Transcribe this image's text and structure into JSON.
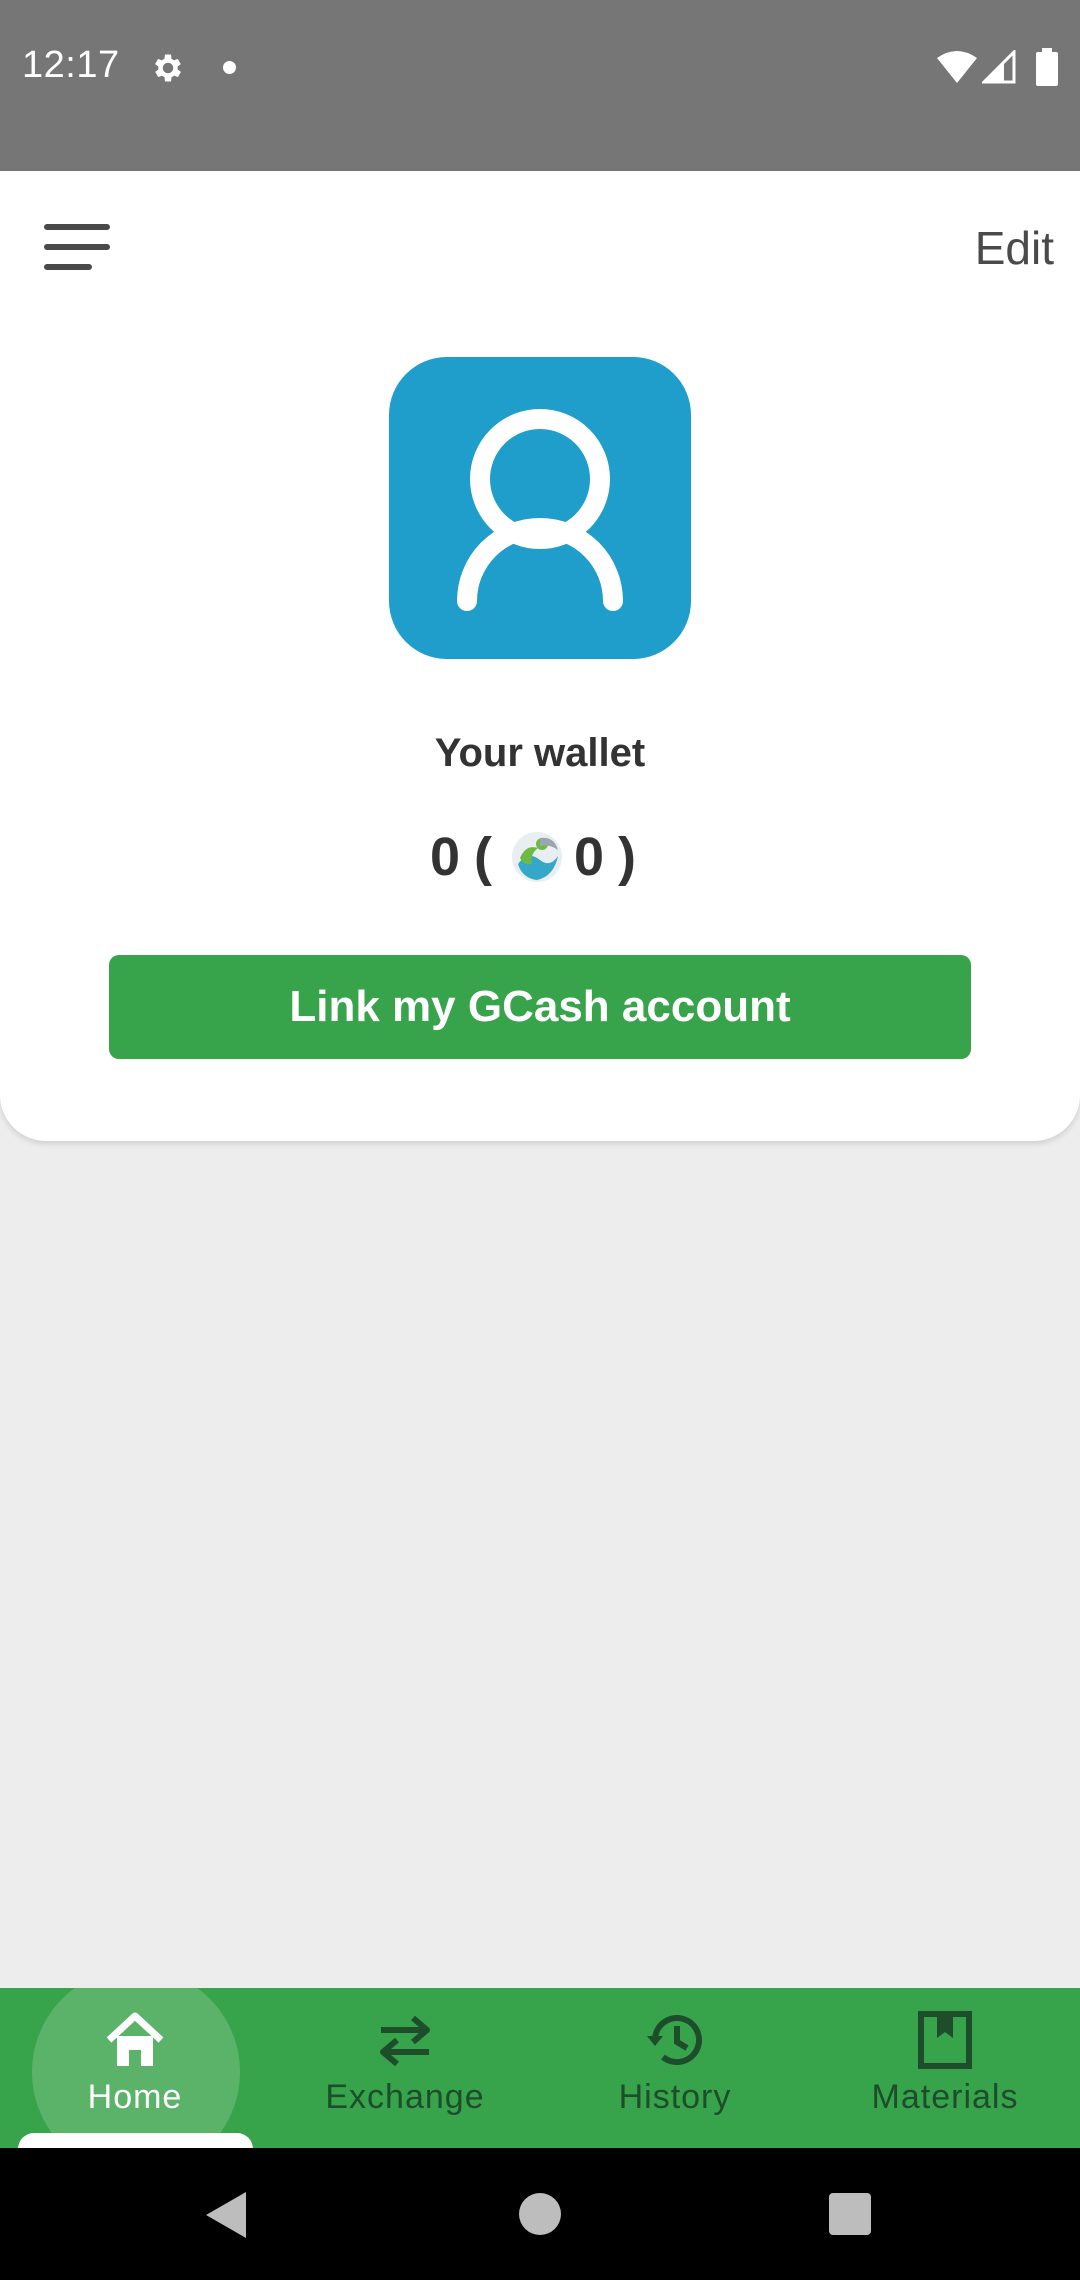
{
  "status_bar": {
    "time": "12:17",
    "icons": [
      "gear-icon",
      "notification-dot",
      "wifi-icon",
      "signal-icon",
      "battery-icon"
    ]
  },
  "header": {
    "menu_icon": "hamburger-menu-icon",
    "edit_label": "Edit"
  },
  "profile": {
    "avatar_icon": "user-icon",
    "avatar_color": "#1f9ecb"
  },
  "wallet": {
    "label": "Your wallet",
    "balance": "0",
    "paren_open": "(",
    "coin_icon": "coin-logo-icon",
    "coin_balance": "0",
    "paren_close": ")"
  },
  "gcash_button": {
    "label": "Link my GCash account",
    "color": "#37a34a"
  },
  "bottom_nav": {
    "color": "#37a34a",
    "active_index": 0,
    "items": [
      {
        "label": "Home",
        "icon": "home-icon"
      },
      {
        "label": "Exchange",
        "icon": "exchange-arrows-icon"
      },
      {
        "label": "History",
        "icon": "history-clock-icon"
      },
      {
        "label": "Materials",
        "icon": "bookmark-box-icon"
      }
    ]
  },
  "system_nav": {
    "buttons": [
      "back-icon",
      "home-circle-icon",
      "recents-square-icon"
    ]
  }
}
